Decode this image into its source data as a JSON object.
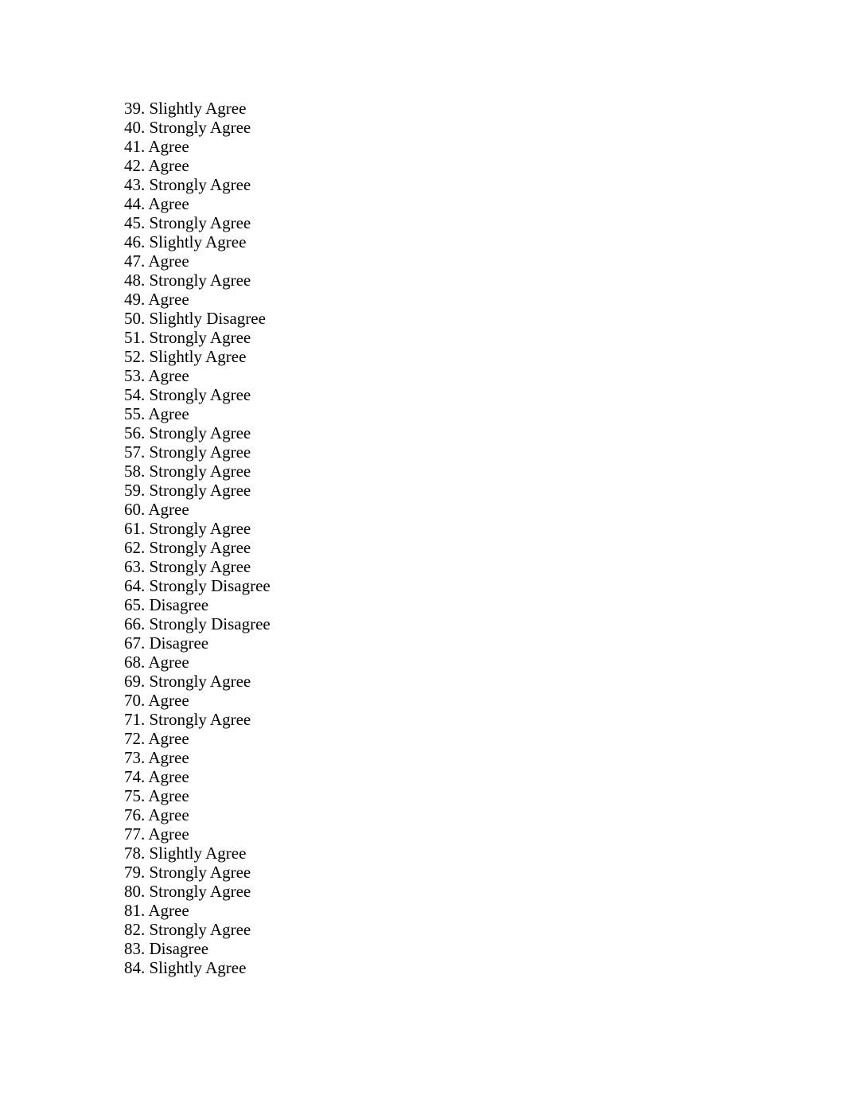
{
  "document": {
    "answers": [
      {
        "number": "39.",
        "response": "Slightly Agree"
      },
      {
        "number": "40.",
        "response": "Strongly Agree"
      },
      {
        "number": "41.",
        "response": "Agree"
      },
      {
        "number": "42.",
        "response": "Agree"
      },
      {
        "number": "43.",
        "response": "Strongly Agree"
      },
      {
        "number": "44.",
        "response": "Agree"
      },
      {
        "number": "45.",
        "response": "Strongly Agree"
      },
      {
        "number": "46.",
        "response": "Slightly Agree"
      },
      {
        "number": "47.",
        "response": "Agree"
      },
      {
        "number": "48.",
        "response": "Strongly Agree"
      },
      {
        "number": "49.",
        "response": "Agree"
      },
      {
        "number": "50.",
        "response": "Slightly Disagree"
      },
      {
        "number": "51.",
        "response": "Strongly Agree"
      },
      {
        "number": "52.",
        "response": "Slightly Agree"
      },
      {
        "number": "53.",
        "response": "Agree"
      },
      {
        "number": "54.",
        "response": "Strongly Agree"
      },
      {
        "number": "55.",
        "response": "Agree"
      },
      {
        "number": "56.",
        "response": "Strongly Agree"
      },
      {
        "number": "57.",
        "response": "Strongly Agree"
      },
      {
        "number": "58.",
        "response": "Strongly Agree"
      },
      {
        "number": "59.",
        "response": "Strongly Agree"
      },
      {
        "number": "60.",
        "response": "Agree"
      },
      {
        "number": "61.",
        "response": "Strongly Agree"
      },
      {
        "number": "62.",
        "response": "Strongly Agree"
      },
      {
        "number": "63.",
        "response": "Strongly Agree"
      },
      {
        "number": "64.",
        "response": "Strongly Disagree"
      },
      {
        "number": "65.",
        "response": "Disagree"
      },
      {
        "number": "66.",
        "response": "Strongly Disagree"
      },
      {
        "number": "67.",
        "response": "Disagree"
      },
      {
        "number": "68.",
        "response": "Agree"
      },
      {
        "number": "69.",
        "response": "Strongly Agree"
      },
      {
        "number": "70.",
        "response": "Agree"
      },
      {
        "number": "71.",
        "response": "Strongly Agree"
      },
      {
        "number": "72.",
        "response": "Agree"
      },
      {
        "number": "73.",
        "response": "Agree"
      },
      {
        "number": "74.",
        "response": "Agree"
      },
      {
        "number": "75.",
        "response": "Agree"
      },
      {
        "number": "76.",
        "response": "Agree"
      },
      {
        "number": "77.",
        "response": "Agree"
      },
      {
        "number": "78.",
        "response": "Slightly Agree"
      },
      {
        "number": "79.",
        "response": "Strongly Agree"
      },
      {
        "number": "80.",
        "response": "Strongly Agree"
      },
      {
        "number": "81.",
        "response": "Agree"
      },
      {
        "number": "82.",
        "response": "Strongly Agree"
      },
      {
        "number": "83.",
        "response": "Disagree"
      },
      {
        "number": "84.",
        "response": "Slightly Agree"
      }
    ]
  }
}
